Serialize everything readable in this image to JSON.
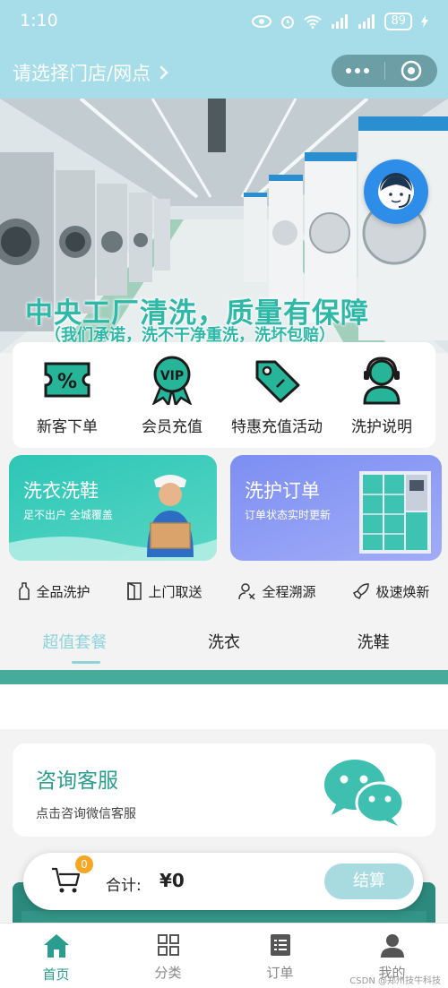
{
  "status_bar": {
    "time": "1:10",
    "battery": "89"
  },
  "header": {
    "store_select_label": "请选择门店/网点"
  },
  "banner": {
    "tagline": "中央工厂清洗，质量有保障",
    "subline": "（我们承诺，洗不干净重洗，洗坏包赔）"
  },
  "quick_menu": [
    {
      "label": "新客下单",
      "icon": "coupon-percent-icon"
    },
    {
      "label": "会员充值",
      "icon": "vip-badge-icon"
    },
    {
      "label": "特惠充值活动",
      "icon": "price-tag-icon"
    },
    {
      "label": "洗护说明",
      "icon": "customer-service-icon"
    }
  ],
  "promo_cards": {
    "wash": {
      "title": "洗衣洗鞋",
      "subtitle": "足不出户  全城覆盖"
    },
    "order": {
      "title": "洗护订单",
      "subtitle": "订单状态实时更新"
    }
  },
  "features": [
    {
      "label": "全品洗护",
      "icon": "bottle-icon"
    },
    {
      "label": "上门取送",
      "icon": "door-icon"
    },
    {
      "label": "全程溯源",
      "icon": "person-trace-icon"
    },
    {
      "label": "极速焕新",
      "icon": "rocket-icon"
    }
  ],
  "tabs": [
    {
      "label": "超值套餐",
      "active": true
    },
    {
      "label": "洗衣",
      "active": false
    },
    {
      "label": "洗鞋",
      "active": false
    }
  ],
  "consult": {
    "title": "咨询客服",
    "subtitle": "点击咨询微信客服"
  },
  "cart": {
    "badge_count": "0",
    "total_label": "合计:",
    "total_value": "¥0",
    "checkout_label": "结算"
  },
  "tab_bar": [
    {
      "label": "首页",
      "icon": "home-icon",
      "active": true
    },
    {
      "label": "分类",
      "icon": "grid-icon",
      "active": false
    },
    {
      "label": "订单",
      "icon": "list-icon",
      "active": false
    },
    {
      "label": "我的",
      "icon": "user-icon",
      "active": false
    }
  ],
  "watermark": "CSDN @郑州技牛科技",
  "colors": {
    "primary": "#2a9d8f",
    "header": "#a6dde9",
    "wash_card": "#2dc6b6",
    "order_card": "#7c8ef2",
    "badge": "#f5a623"
  }
}
